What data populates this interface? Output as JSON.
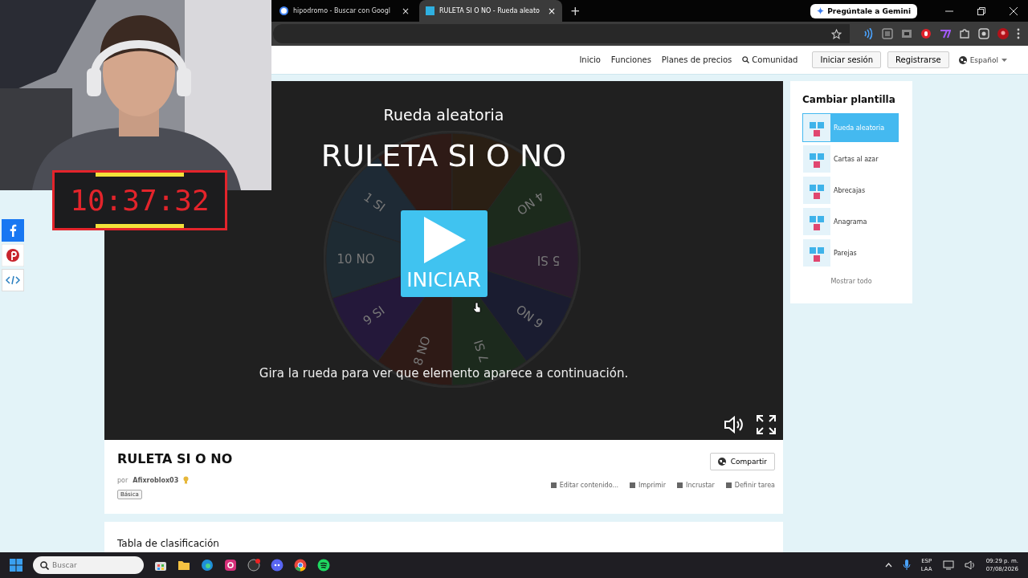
{
  "browser": {
    "tabs": [
      {
        "title": "hipodromo - Buscar con Googl",
        "selected": false
      },
      {
        "title": "RULETA SI O NO - Rueda aleato",
        "selected": true
      }
    ],
    "tab_close": "×",
    "new_tab": "+",
    "gemini_button": "Pregúntale a Gemini"
  },
  "site_nav": {
    "links": [
      "Inicio",
      "Funciones",
      "Planes de precios",
      "Comunidad"
    ],
    "login": "Iniciar sesión",
    "register": "Registrarse",
    "language": "Español"
  },
  "game": {
    "subtitle": "Rueda aleatoria",
    "title": "RULETA SI O NO",
    "wheel_labels": [
      "1 SI",
      "4 NO",
      "5 SI",
      "6 NO",
      "7 SI",
      "8 NO",
      "9 SI",
      "10 NO"
    ],
    "start_button": "INICIAR",
    "instruction": "Gira la rueda para ver que elemento aparece a continuación."
  },
  "template_panel": {
    "title": "Cambiar plantilla",
    "items": [
      {
        "label": "Rueda aleatoria",
        "selected": true
      },
      {
        "label": "Cartas al azar",
        "selected": false
      },
      {
        "label": "Abrecajas",
        "selected": false
      },
      {
        "label": "Anagrama",
        "selected": false
      },
      {
        "label": "Parejas",
        "selected": false
      }
    ],
    "show_all": "Mostrar todo"
  },
  "activity": {
    "title": "RULETA SI O NO",
    "by": "por",
    "author": "Afixroblox03",
    "tag": "Básica",
    "share": "Compartir",
    "actions": [
      "Editar contenido...",
      "Imprimir",
      "Incrustar",
      "Definir tarea"
    ]
  },
  "leaderboard": {
    "title": "Tabla de clasificación"
  },
  "overlay": {
    "timer": "10:37:32"
  },
  "taskbar": {
    "search_placeholder": "Buscar",
    "lang": "ESP",
    "layout": "LAA",
    "time": "09:29 p. m.",
    "date": "07/08/2026"
  }
}
